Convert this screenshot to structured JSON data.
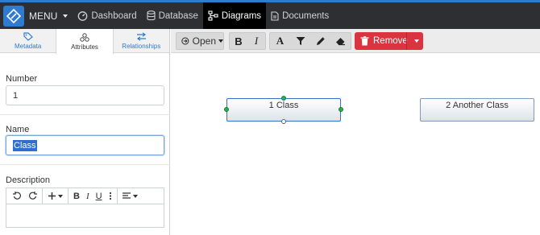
{
  "topnav": {
    "menu_label": "MENU",
    "items": [
      {
        "label": "Dashboard"
      },
      {
        "label": "Database"
      },
      {
        "label": "Diagrams"
      },
      {
        "label": "Documents"
      }
    ]
  },
  "left_panel": {
    "tabs": [
      {
        "label": "Metadata"
      },
      {
        "label": "Attributes"
      },
      {
        "label": "Relationships"
      }
    ],
    "fields": {
      "number_label": "Number",
      "number_value": "1",
      "name_label": "Name",
      "name_value": "Class",
      "description_label": "Description"
    },
    "editor_toolbar": {
      "bold": "B",
      "italic": "I",
      "underline": "U"
    }
  },
  "toolbar": {
    "open_label": "Open",
    "bold": "B",
    "italic": "I",
    "font": "A",
    "remove_label": "Remove"
  },
  "diagram": {
    "nodes": [
      {
        "label": "1 Class",
        "selected": true
      },
      {
        "label": "2 Another Class",
        "selected": false
      }
    ]
  },
  "colors": {
    "accent": "#2e7bcf",
    "danger": "#d9343f",
    "nav_bg": "#2d2f33",
    "selection_handle": "#28b04a"
  }
}
